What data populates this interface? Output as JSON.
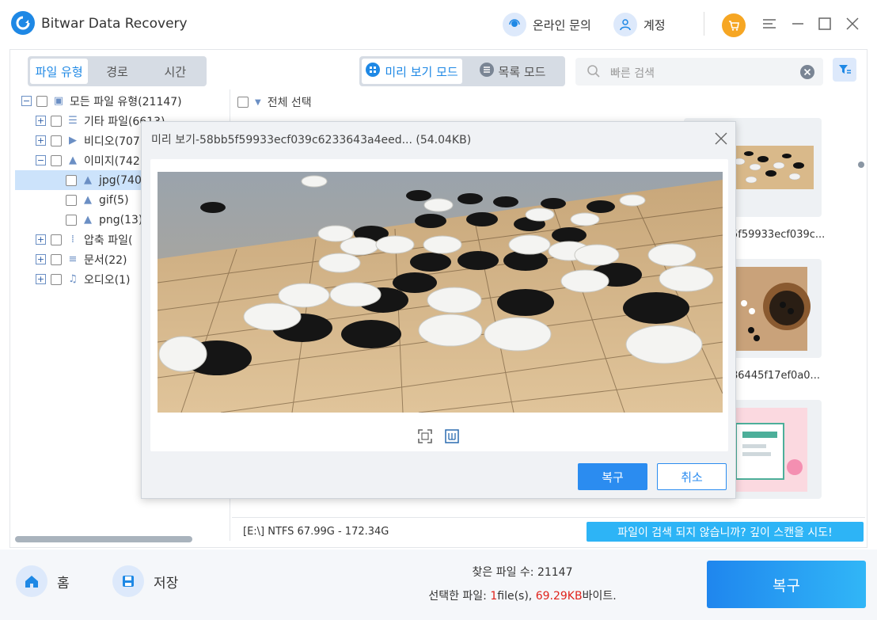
{
  "app": {
    "title": "Bitwar Data Recovery"
  },
  "titlebar": {
    "online": "온라인 문의",
    "account": "계정"
  },
  "tabs": [
    "파일 유형",
    "경로",
    "시간"
  ],
  "modes": {
    "preview": "미리 보기 모드",
    "list": "목록 모드"
  },
  "search": {
    "placeholder": "빠른 검색"
  },
  "tree": {
    "root": "모든 파일 유형(21147)",
    "other": "기타 파일(6613)",
    "video": "비디오(707",
    "image": "이미지(742",
    "jpg": "jpg(740",
    "gif": "gif(5)",
    "png": "png(13)",
    "archive": "압축 파일(",
    "doc": "문서(22)",
    "audio": "오디오(1)"
  },
  "content": {
    "select_all": "전체 선택",
    "thumb1_label": "5f59933ecf039c...",
    "thumb2_label": "86445f17ef0a0..."
  },
  "footer": {
    "drive": "[E:\\] NTFS 67.99G - 172.34G",
    "deep_scan": "파일이 검색 되지 않습니까? 깊이 스캔을 시도!"
  },
  "bottom": {
    "home": "홈",
    "save": "저장",
    "found_label": "찾은 파일 수: 21147",
    "selected_prefix": "선택한 파일: ",
    "selected_count": "1",
    "selected_unit": "file(s), ",
    "selected_size": "69.29KB",
    "selected_suffix": "바이트.",
    "recover": "복구"
  },
  "dialog": {
    "title": "미리 보기-58bb5f59933ecf039c6233643a4eed... (54.04KB)",
    "ok": "복구",
    "cancel": "취소"
  },
  "colors": {
    "accent": "#1e88e5",
    "deep_scan_bg": "#2db4f6",
    "highlight": "#e0231c"
  }
}
